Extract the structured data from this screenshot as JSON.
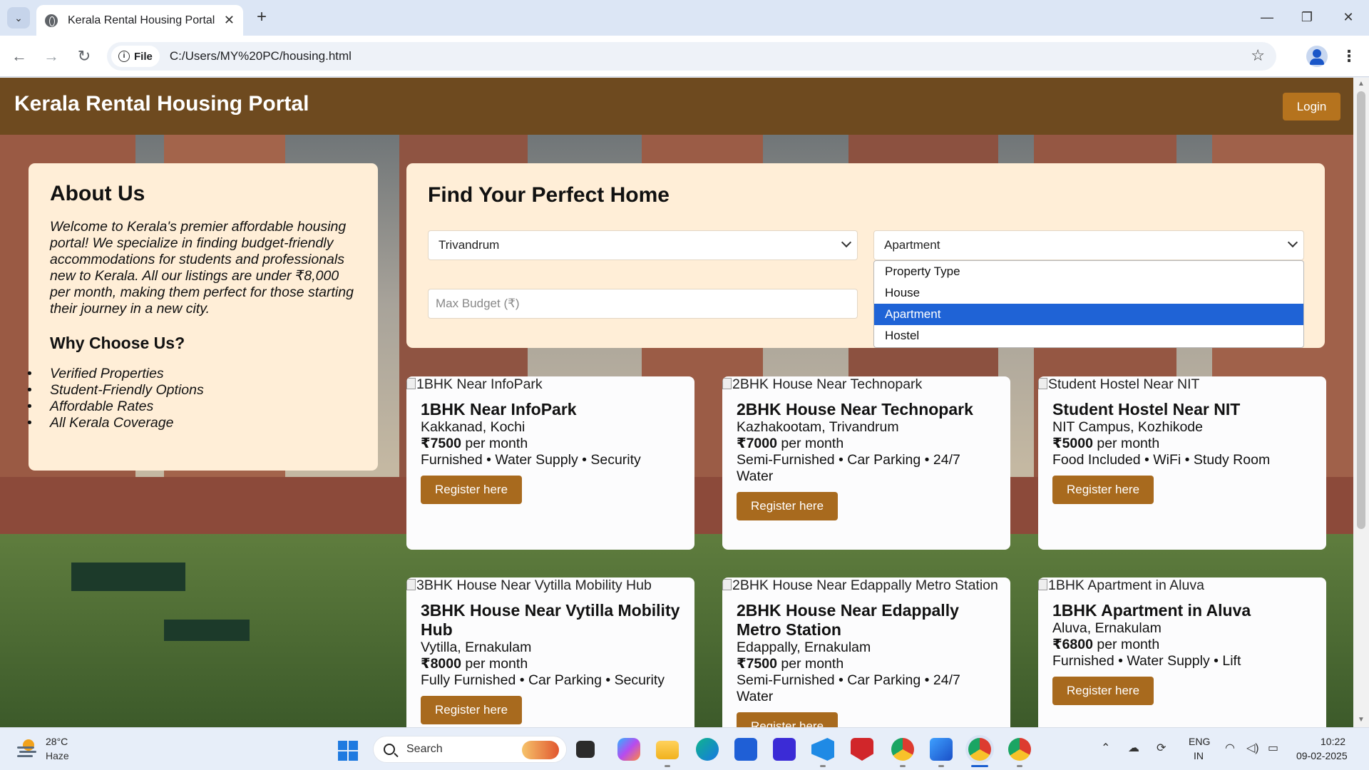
{
  "browser": {
    "tab_title": "Kerala Rental Housing Portal",
    "close_glyph": "✕",
    "new_tab_glyph": "+",
    "omnibox_scheme": "File",
    "url": "C:/Users/MY%20PC/housing.html",
    "window_controls": [
      "—",
      "❐",
      "✕"
    ]
  },
  "site": {
    "title": "Kerala Rental Housing Portal",
    "login_label": "Login",
    "brand_color": "#6e4a1f",
    "accent_color": "#a86a1e"
  },
  "about": {
    "heading": "About Us",
    "text": "Welcome to Kerala's premier affordable housing portal! We specialize in finding budget-friendly accommodations for students and professionals new to Kerala. All our listings are under ₹8,000 per month, making them perfect for those starting their journey in a new city.",
    "why_heading": "Why Choose Us?",
    "reasons": [
      "Verified Properties",
      "Student-Friendly Options",
      "Affordable Rates",
      "All Kerala Coverage"
    ]
  },
  "search": {
    "heading": "Find Your Perfect Home",
    "city_value": "Trivandrum",
    "type_value": "Apartment",
    "budget_placeholder": "Max Budget (₹)",
    "type_options": [
      "Property Type",
      "House",
      "Apartment",
      "Hostel"
    ],
    "type_selected_index": 2
  },
  "listings": [
    {
      "alt": "1BHK Near InfoPark",
      "title": "1BHK Near InfoPark",
      "location": "Kakkanad, Kochi",
      "price": "₹7500",
      "price_suffix": " per month",
      "features": "Furnished • Water Supply • Security",
      "button": "Register here"
    },
    {
      "alt": "2BHK House Near Technopark",
      "title": "2BHK House Near Technopark",
      "location": "Kazhakootam, Trivandrum",
      "price": "₹7000",
      "price_suffix": " per month",
      "features": "Semi-Furnished • Car Parking • 24/7 Water",
      "button": "Register here"
    },
    {
      "alt": "Student Hostel Near NIT",
      "title": "Student Hostel Near NIT",
      "location": "NIT Campus, Kozhikode",
      "price": "₹5000",
      "price_suffix": " per month",
      "features": "Food Included • WiFi • Study Room",
      "button": "Register here"
    },
    {
      "alt": "3BHK House Near Vytilla Mobility Hub",
      "title": "3BHK House Near Vytilla Mobility Hub",
      "location": "Vytilla, Ernakulam",
      "price": "₹8000",
      "price_suffix": " per month",
      "features": "Fully Furnished • Car Parking • Security",
      "button": "Register here"
    },
    {
      "alt": "2BHK House Near Edappally Metro Station",
      "title": "2BHK House Near Edappally Metro Station",
      "location": "Edappally, Ernakulam",
      "price": "₹7500",
      "price_suffix": " per month",
      "features": "Semi-Furnished • Car Parking • 24/7 Water",
      "button": "Register here"
    },
    {
      "alt": "1BHK Apartment in Aluva",
      "title": "1BHK Apartment in Aluva",
      "location": "Aluva, Ernakulam",
      "price": "₹6800",
      "price_suffix": " per month",
      "features": "Furnished • Water Supply • Lift",
      "button": "Register here"
    }
  ],
  "taskbar": {
    "temperature": "28°C",
    "condition": "Haze",
    "search_label": "Search",
    "lang_top": "ENG",
    "lang_bottom": "IN",
    "time": "10:22",
    "date": "09-02-2025"
  }
}
